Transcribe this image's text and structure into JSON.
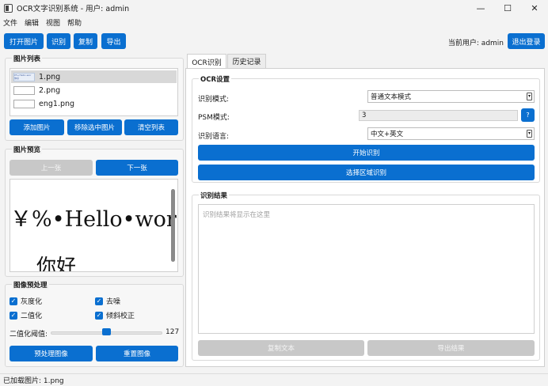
{
  "window": {
    "title": "OCR文字识别系统 - 用户: admin",
    "controls": {
      "minimize": "—",
      "maximize": "☐",
      "close": "✕"
    }
  },
  "menu": [
    "文件",
    "编辑",
    "视图",
    "帮助"
  ],
  "toolbar": {
    "open_image": "打开图片",
    "recognize": "识别",
    "copy": "复制",
    "export": "导出",
    "current_user": "当前用户: admin",
    "logout": "退出登录"
  },
  "image_list": {
    "title": "图片列表",
    "files": [
      {
        "name": "1.png",
        "selected": true
      },
      {
        "name": "2.png",
        "selected": false
      },
      {
        "name": "eng1.png",
        "selected": false
      }
    ],
    "add": "添加图片",
    "remove": "移除选中图片",
    "clear": "清空列表"
  },
  "preview": {
    "title": "图片预览",
    "prev": "上一张",
    "next": "下一张",
    "line1": "￥%•Hello•wor",
    "line2": "你好"
  },
  "preprocess": {
    "title": "图像预处理",
    "options": [
      {
        "label": "灰度化",
        "checked": true
      },
      {
        "label": "去噪",
        "checked": true
      },
      {
        "label": "二值化",
        "checked": true
      },
      {
        "label": "倾斜校正",
        "checked": true
      }
    ],
    "threshold_label": "二值化阈值:",
    "threshold_value": "127",
    "threshold_fraction": 0.5,
    "preprocess_btn": "预处理图像",
    "reset_btn": "重置图像"
  },
  "tabs": [
    {
      "label": "OCR识别",
      "active": true
    },
    {
      "label": "历史记录",
      "active": false
    }
  ],
  "ocr_settings": {
    "title": "OCR设置",
    "mode_label": "识别模式:",
    "mode_value": "普通文本模式",
    "psm_label": "PSM模式:",
    "psm_value": "3",
    "help": "?",
    "lang_label": "识别语言:",
    "lang_value": "中文+英文",
    "start": "开始识别",
    "region": "选择区域识别"
  },
  "result": {
    "title": "识别结果",
    "placeholder": "识别结果将显示在这里",
    "copy_text": "复制文本",
    "export_result": "导出结果"
  },
  "status": "已加载图片: 1.png",
  "colors": {
    "accent": "#0a6fd0",
    "disabled": "#c8c8c8"
  }
}
